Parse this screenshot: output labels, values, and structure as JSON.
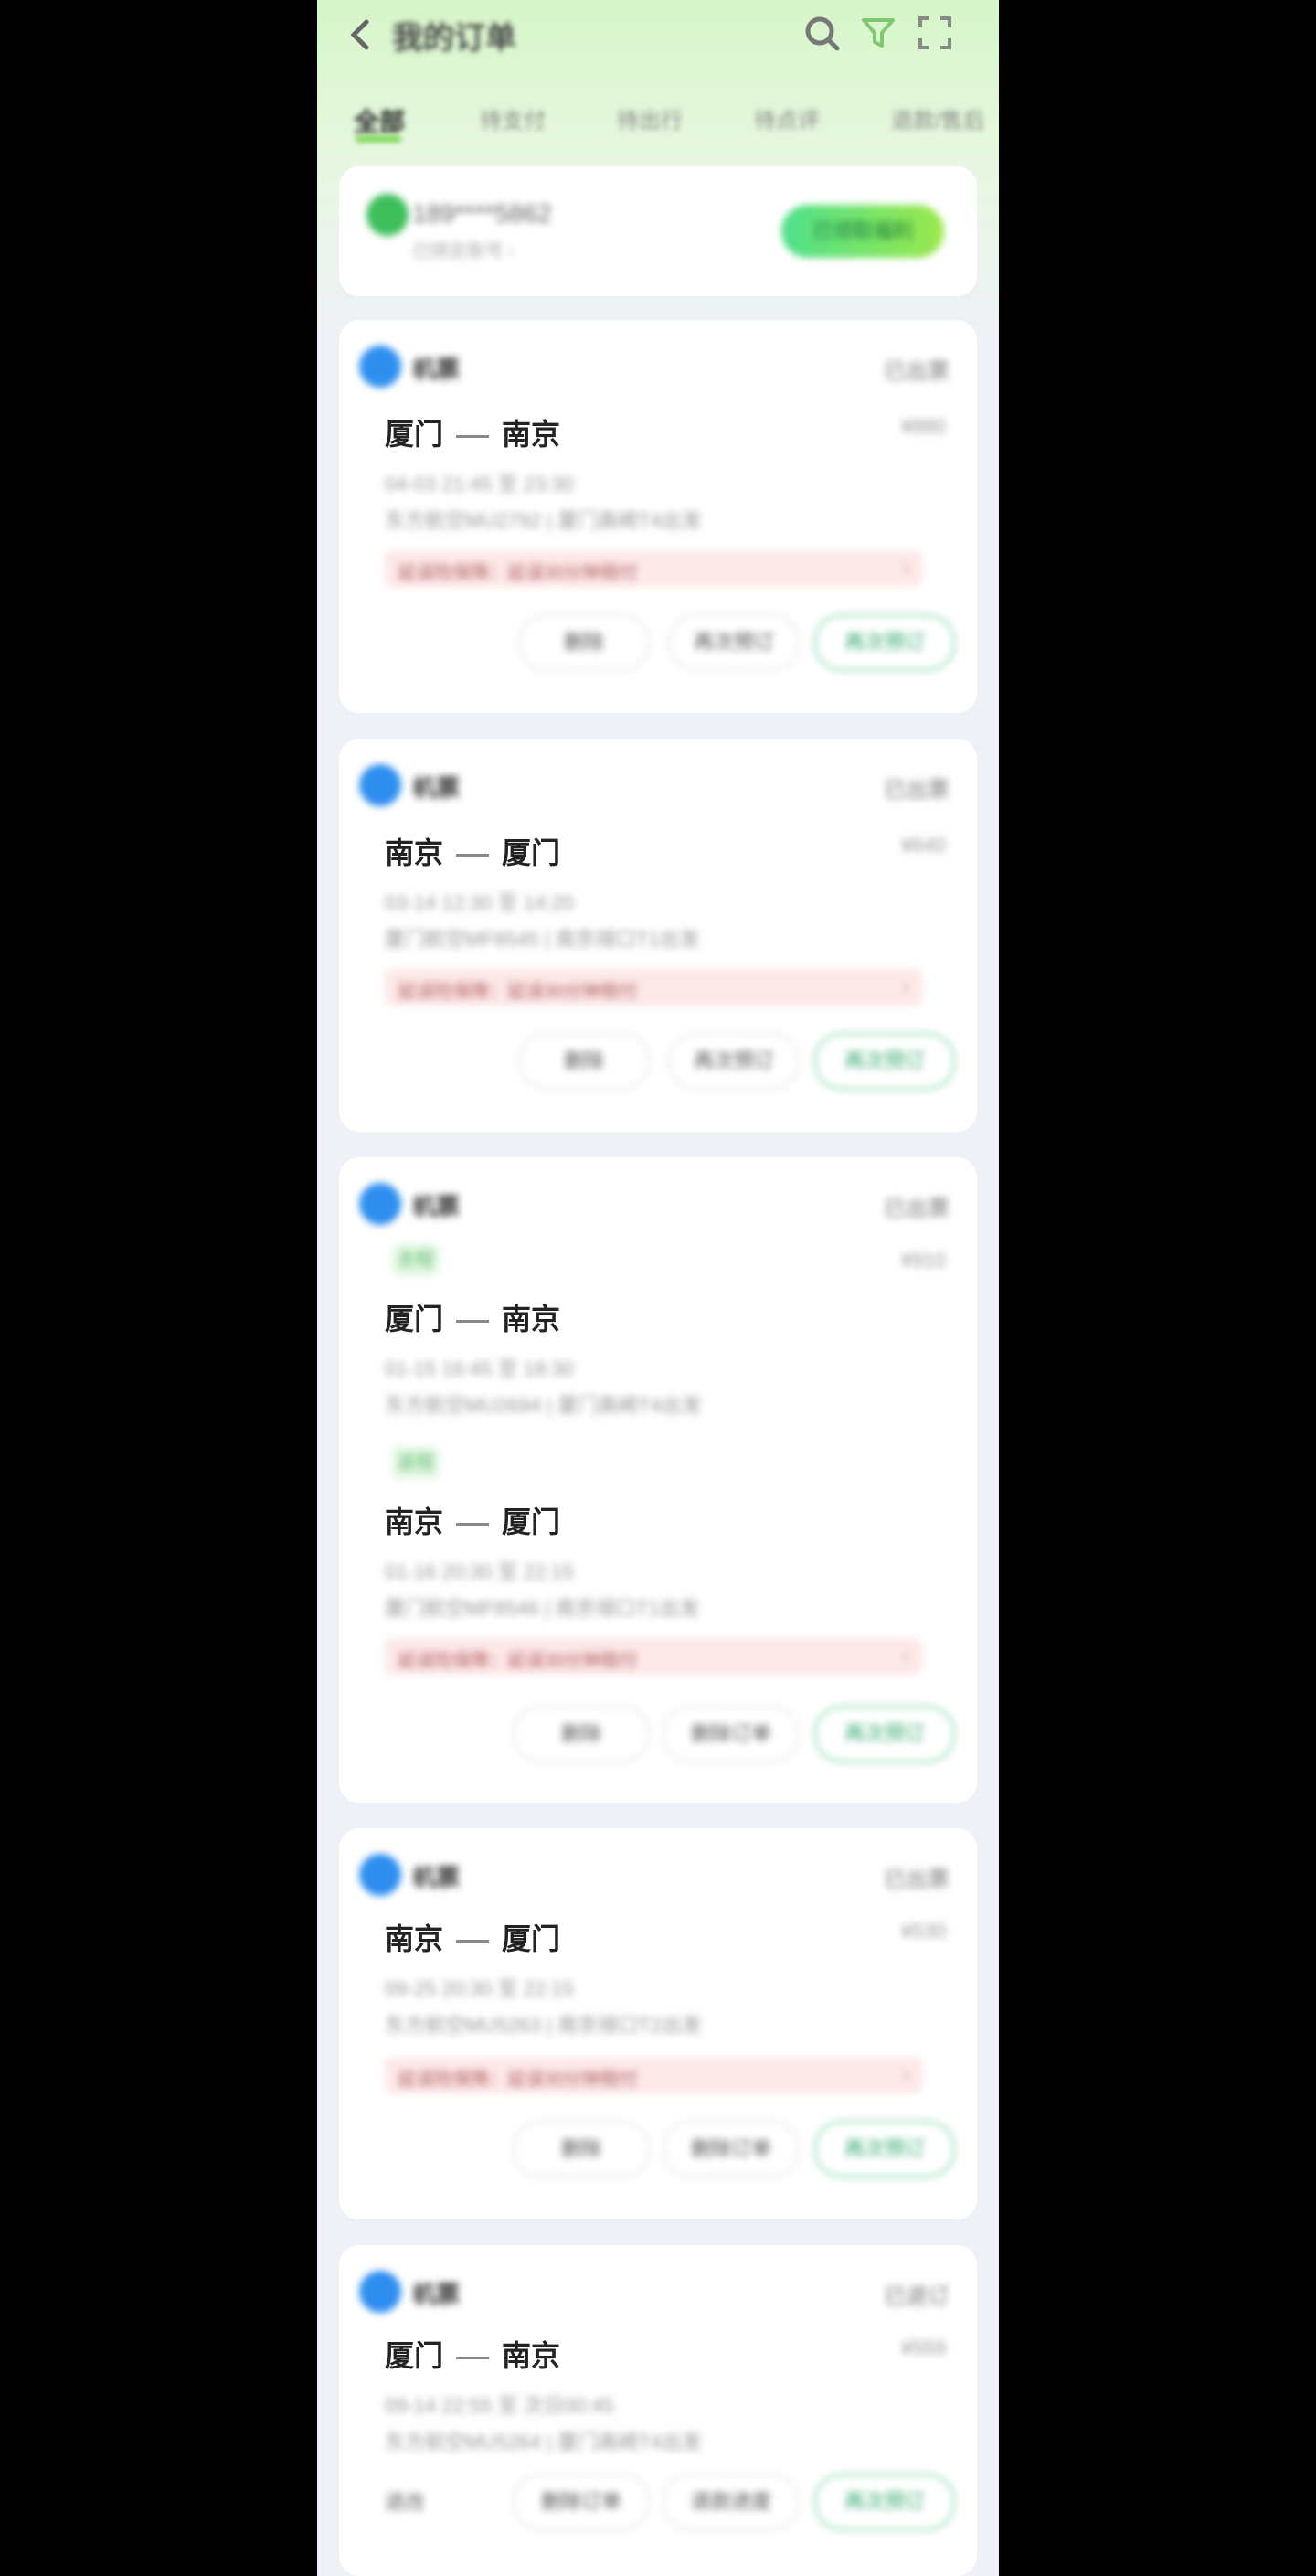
{
  "header": {
    "title": "我的订单",
    "back_icon": "chevron-left-icon",
    "icons": [
      "search-icon",
      "filter-icon",
      "scan-icon"
    ]
  },
  "tabs": [
    {
      "label": "全部",
      "active": true
    },
    {
      "label": "待支付",
      "active": false
    },
    {
      "label": "待出行",
      "active": false
    },
    {
      "label": "待点评",
      "active": false
    },
    {
      "label": "退款/售后",
      "active": false
    }
  ],
  "member": {
    "phone": "189****5862",
    "subtitle": "已绑定账号 ›",
    "button": "已领取福利"
  },
  "orders": [
    {
      "brand": "机票",
      "status": "已出票",
      "legs": [
        {
          "tag": "",
          "from": "厦门",
          "to": "南京",
          "time": "04-03 21:45 至 23:30",
          "flight": "东方航空MU2792 | 厦门高崎T4出发"
        }
      ],
      "price": "¥880",
      "alert": "延误险保障：延误30分钟赔付",
      "buttons": [
        "删除",
        "再次预订",
        "再次预订"
      ]
    },
    {
      "brand": "机票",
      "status": "已出票",
      "legs": [
        {
          "tag": "",
          "from": "南京",
          "to": "厦门",
          "time": "03-14 12:30 至 14:20",
          "flight": "厦门航空MF8545 | 南京禄口T1出发"
        }
      ],
      "price": "¥640",
      "alert": "延误险保障：延误30分钟赔付",
      "buttons": [
        "删除",
        "再次预订",
        "再次预订"
      ]
    },
    {
      "brand": "机票",
      "status": "已出票",
      "legs": [
        {
          "tag": "去程",
          "from": "厦门",
          "to": "南京",
          "time": "01-15 16:45 至 18:30",
          "flight": "东方航空MU2694 | 厦门高崎T4出发"
        },
        {
          "tag": "返程",
          "from": "南京",
          "to": "厦门",
          "time": "01-16 20:30 至 22:15",
          "flight": "厦门航空MF8546 | 南京禄口T1出发"
        }
      ],
      "price": "¥910",
      "alert": "延误险保障：延误30分钟赔付",
      "buttons": [
        "删除",
        "删除订单",
        "再次预订"
      ]
    },
    {
      "brand": "机票",
      "status": "已出票",
      "legs": [
        {
          "tag": "",
          "from": "南京",
          "to": "厦门",
          "time": "09-25 20:30 至 22:15",
          "flight": "东方航空MU5263 | 南京禄口T2出发"
        }
      ],
      "price": "¥530",
      "alert": "延误险保障：延误30分钟赔付",
      "buttons": [
        "删除",
        "删除订单",
        "再次预订"
      ]
    },
    {
      "brand": "机票",
      "status": "已退订",
      "legs": [
        {
          "tag": "",
          "from": "厦门",
          "to": "南京",
          "time": "09-14 22:55 至 次日00:45",
          "flight": "东方航空MU5264 | 厦门高崎T4出发"
        }
      ],
      "price": "¥559",
      "alert": "",
      "left_text": "退改",
      "buttons": [
        "删除订单",
        "退款进度",
        "再次预订"
      ]
    }
  ]
}
